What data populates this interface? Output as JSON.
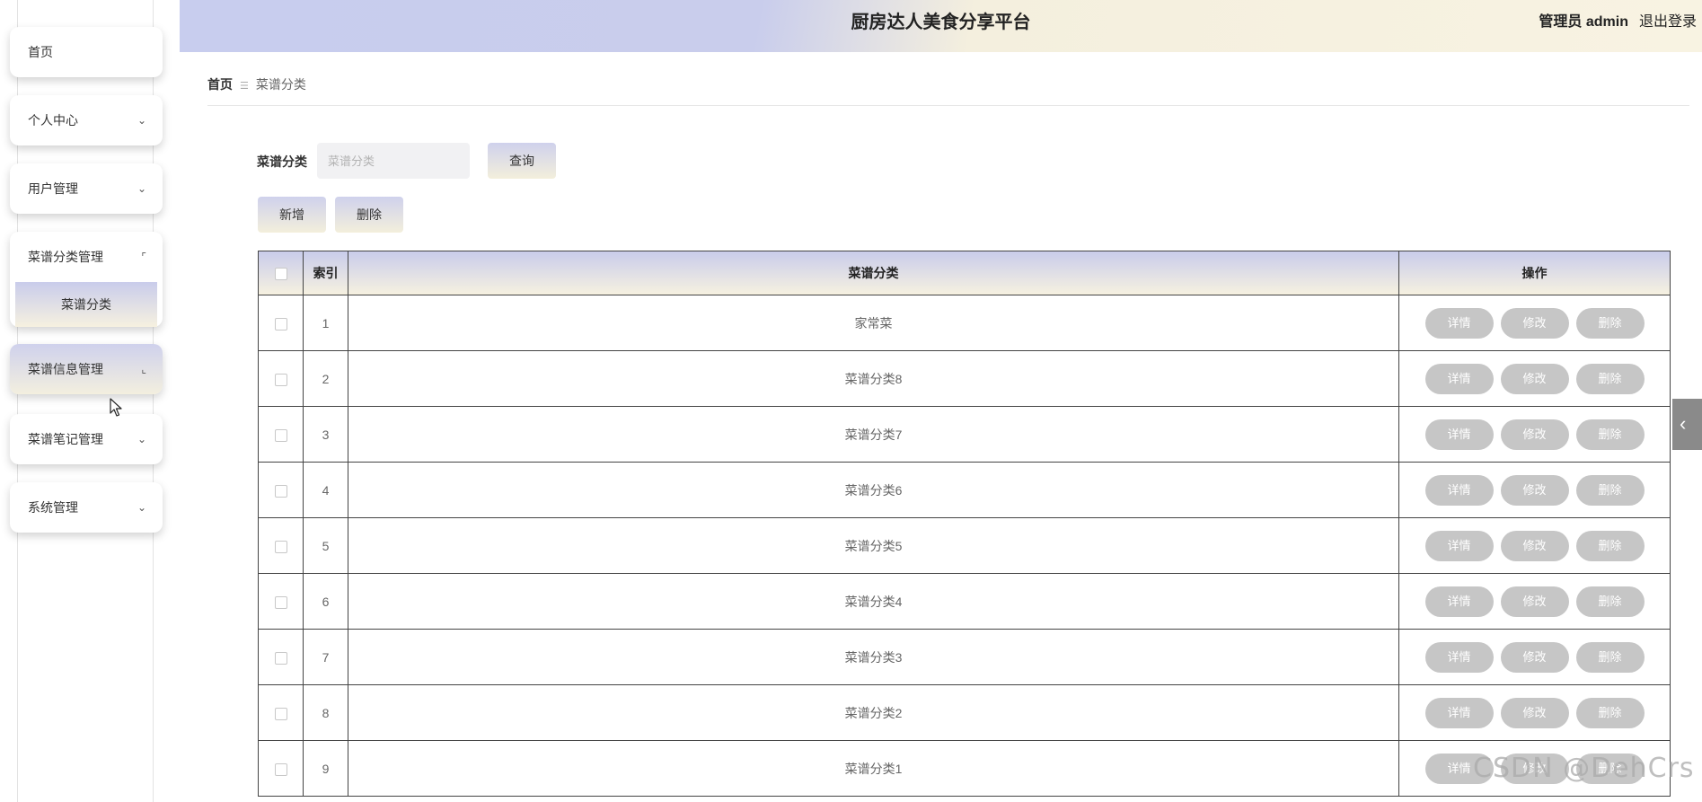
{
  "header": {
    "title": "厨房达人美食分享平台",
    "user": "管理员 admin",
    "logout": "退出登录"
  },
  "sidebar": {
    "items": [
      {
        "label": "首页"
      },
      {
        "label": "个人中心",
        "chevron": "⌄"
      },
      {
        "label": "用户管理",
        "chevron": "⌄"
      },
      {
        "label": "菜谱分类管理",
        "chevron": "⌜",
        "children": [
          {
            "label": "菜谱分类"
          }
        ]
      },
      {
        "label": "菜谱信息管理",
        "chevron": "⌞"
      },
      {
        "label": "菜谱笔记管理",
        "chevron": "⌄"
      },
      {
        "label": "系统管理",
        "chevron": "⌄"
      }
    ]
  },
  "breadcrumb": {
    "home": "首页",
    "separator": "☰",
    "current": "菜谱分类"
  },
  "search": {
    "label": "菜谱分类",
    "placeholder": "菜谱分类",
    "button": "查询"
  },
  "actions": {
    "add": "新增",
    "delete": "删除"
  },
  "table": {
    "headers": {
      "index": "索引",
      "category": "菜谱分类",
      "ops": "操作"
    },
    "row_buttons": {
      "detail": "详情",
      "edit": "修改",
      "delete": "删除"
    },
    "rows": [
      {
        "index": "1",
        "category": "家常菜"
      },
      {
        "index": "2",
        "category": "菜谱分类8"
      },
      {
        "index": "3",
        "category": "菜谱分类7"
      },
      {
        "index": "4",
        "category": "菜谱分类6"
      },
      {
        "index": "5",
        "category": "菜谱分类5"
      },
      {
        "index": "6",
        "category": "菜谱分类4"
      },
      {
        "index": "7",
        "category": "菜谱分类3"
      },
      {
        "index": "8",
        "category": "菜谱分类2"
      },
      {
        "index": "9",
        "category": "菜谱分类1"
      }
    ]
  },
  "side_tab": {
    "icon": "chevron-left-icon",
    "glyph": "‹"
  },
  "watermark": "CSDN @DehCrs",
  "colors": {
    "accent_from": "#c9cceb",
    "accent_to": "#f6f1e0",
    "row_button": "#c6c6c6"
  }
}
